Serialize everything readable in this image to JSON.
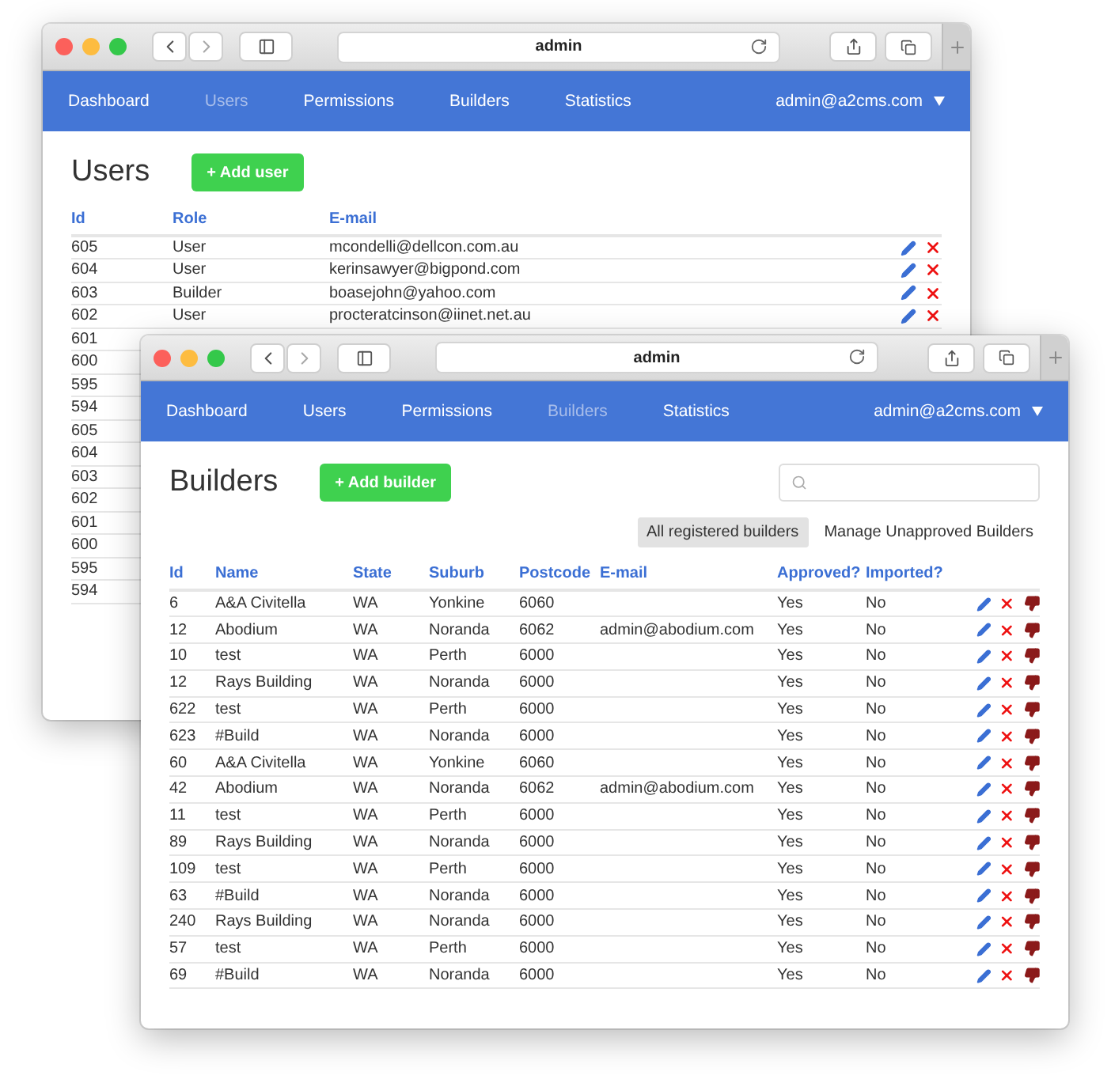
{
  "back_window": {
    "address": "admin",
    "nav": [
      {
        "label": "Dashboard",
        "selected": false
      },
      {
        "label": "Users",
        "selected": true
      },
      {
        "label": "Permissions",
        "selected": false
      },
      {
        "label": "Builders",
        "selected": false
      },
      {
        "label": "Statistics",
        "selected": false
      }
    ],
    "account": "admin@a2cms.com",
    "heading": "Users",
    "add_button": "+ Add user",
    "columns": [
      "Id",
      "Role",
      "E-mail"
    ],
    "rows": [
      {
        "id": "605",
        "role": "User",
        "email": "mcondelli@dellcon.com.au"
      },
      {
        "id": "604",
        "role": "User",
        "email": "kerinsawyer@bigpond.com"
      },
      {
        "id": "603",
        "role": "Builder",
        "email": "boasejohn@yahoo.com"
      },
      {
        "id": "602",
        "role": "User",
        "email": "procteratcinson@iinet.net.au"
      },
      {
        "id": "601"
      },
      {
        "id": "600"
      },
      {
        "id": "595"
      },
      {
        "id": "594"
      },
      {
        "id": "605"
      },
      {
        "id": "604"
      },
      {
        "id": "603"
      },
      {
        "id": "602"
      },
      {
        "id": "601"
      },
      {
        "id": "600"
      },
      {
        "id": "595"
      },
      {
        "id": "594"
      }
    ]
  },
  "front_window": {
    "address": "admin",
    "nav": [
      {
        "label": "Dashboard",
        "selected": false
      },
      {
        "label": "Users",
        "selected": false
      },
      {
        "label": "Permissions",
        "selected": false
      },
      {
        "label": "Builders",
        "selected": true
      },
      {
        "label": "Statistics",
        "selected": false
      }
    ],
    "account": "admin@a2cms.com",
    "heading": "Builders",
    "add_button": "+ Add builder",
    "tabs": [
      {
        "label": "All registered builders",
        "selected": true
      },
      {
        "label": "Manage Unapproved Builders",
        "selected": false
      }
    ],
    "columns": [
      "Id",
      "Name",
      "State",
      "Suburb",
      "Postcode",
      "E-mail",
      "Approved?",
      "Imported?"
    ],
    "rows": [
      {
        "id": "6",
        "name": "A&A Civitella",
        "state": "WA",
        "suburb": "Yonkine",
        "postcode": "6060",
        "approved": "Yes",
        "imported": "No"
      },
      {
        "id": "12",
        "name": "Abodium",
        "state": "WA",
        "suburb": "Noranda",
        "postcode": "6062",
        "email": "admin@abodium.com",
        "approved": "Yes",
        "imported": "No"
      },
      {
        "id": "10",
        "name": "test",
        "state": "WA",
        "suburb": "Perth",
        "postcode": "6000",
        "approved": "Yes",
        "imported": "No"
      },
      {
        "id": "12",
        "name": "Rays Building",
        "state": "WA",
        "suburb": "Noranda",
        "postcode": "6000",
        "approved": "Yes",
        "imported": "No"
      },
      {
        "id": "622",
        "name": "test",
        "state": "WA",
        "suburb": "Perth",
        "postcode": "6000",
        "approved": "Yes",
        "imported": "No"
      },
      {
        "id": "623",
        "name": "#Build",
        "state": "WA",
        "suburb": "Noranda",
        "postcode": "6000",
        "approved": "Yes",
        "imported": "No"
      },
      {
        "id": "60",
        "name": "A&A Civitella",
        "state": "WA",
        "suburb": "Yonkine",
        "postcode": "6060",
        "approved": "Yes",
        "imported": "No"
      },
      {
        "id": "42",
        "name": "Abodium",
        "state": "WA",
        "suburb": "Noranda",
        "postcode": "6062",
        "email": "admin@abodium.com",
        "approved": "Yes",
        "imported": "No"
      },
      {
        "id": "11",
        "name": "test",
        "state": "WA",
        "suburb": "Perth",
        "postcode": "6000",
        "approved": "Yes",
        "imported": "No"
      },
      {
        "id": "89",
        "name": "Rays Building",
        "state": "WA",
        "suburb": "Noranda",
        "postcode": "6000",
        "approved": "Yes",
        "imported": "No"
      },
      {
        "id": "109",
        "name": "test",
        "state": "WA",
        "suburb": "Perth",
        "postcode": "6000",
        "approved": "Yes",
        "imported": "No"
      },
      {
        "id": "63",
        "name": "#Build",
        "state": "WA",
        "suburb": "Noranda",
        "postcode": "6000",
        "approved": "Yes",
        "imported": "No"
      },
      {
        "id": "240",
        "name": "Rays Building",
        "state": "WA",
        "suburb": "Noranda",
        "postcode": "6000",
        "approved": "Yes",
        "imported": "No"
      },
      {
        "id": "57",
        "name": "test",
        "state": "WA",
        "suburb": "Perth",
        "postcode": "6000",
        "approved": "Yes",
        "imported": "No"
      },
      {
        "id": "69",
        "name": "#Build",
        "state": "WA",
        "suburb": "Noranda",
        "postcode": "6000",
        "approved": "Yes",
        "imported": "No"
      }
    ]
  }
}
